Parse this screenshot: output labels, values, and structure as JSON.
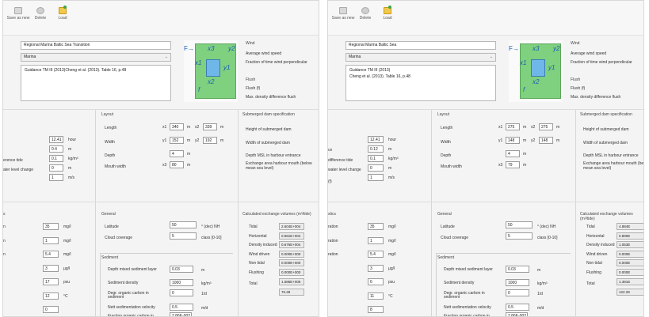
{
  "toolbar": {
    "save_label": "Save as new",
    "delete_label": "Delete",
    "load_label": "Load"
  },
  "left": {
    "title": "Regional Marina Baltic Sea Transition",
    "type_value": "Marina",
    "reference_lines": [
      "Guidance TM III (2013)Cheng et al. (2013). Table 16, p.48"
    ],
    "diagram": {
      "f_arrow": "F→",
      "x1": "x1",
      "x2": "x2",
      "x3": "x3",
      "y1": "y1",
      "y2": "y2",
      "f": "f"
    },
    "wind": {
      "header": "Wind",
      "items": [
        "Average wind speed",
        "Fraction of time wind perpendicular"
      ]
    },
    "flush": {
      "header": "Flush",
      "items": [
        "Flush (f)",
        "Max. density difference flush"
      ]
    },
    "sea_labels": [
      "erence tide",
      "ater level change"
    ],
    "sea_values": [
      "12.41",
      "0.4",
      "0.1",
      "0",
      "1"
    ],
    "sea_units": [
      "hour",
      "m",
      "kg/m³",
      "m",
      "m/s"
    ],
    "layout": {
      "header": "Layout",
      "length_label": "Length",
      "width_label": "Width",
      "depth_label": "Depth",
      "mouth_label": "Mouth width",
      "x1": "340",
      "x2": "339",
      "y1": "152",
      "y2": "192",
      "depth": "4",
      "x3": "80",
      "tag_x1": "x1",
      "tag_x2": "x2",
      "tag_y1": "y1",
      "tag_y2": "y2",
      "tag_x3": "x3",
      "unit": "m"
    },
    "submerged": {
      "header": "Submerged dam specification",
      "items": [
        "Height of submerged dam",
        "Width of submerged dam",
        "Depth MSL in harbour entrance",
        "Exchange area harbour mouth (below mean sea level)"
      ]
    },
    "chem_header": "s",
    "chem_rows": [
      {
        "label": "n",
        "value": "35",
        "unit": "mg/l"
      },
      {
        "label": "n",
        "value": "1",
        "unit": "mg/l"
      },
      {
        "label": "n",
        "value": "5.4",
        "unit": "mg/l"
      },
      {
        "label": "",
        "value": "3",
        "unit": "µg/l"
      },
      {
        "label": "",
        "value": "17",
        "unit": "psu"
      },
      {
        "label": "",
        "value": "12",
        "unit": "°C"
      },
      {
        "label": "",
        "value": "0",
        "unit": ""
      }
    ],
    "general": {
      "header": "General",
      "lat_label": "Latitude",
      "lat_value": "50",
      "lat_unit": "° (dec) NH",
      "cloud_label": "Cloud coverage",
      "cloud_value": "5",
      "cloud_unit": "class [0-10]"
    },
    "sediment": {
      "header": "Sediment",
      "rows": [
        {
          "label": "Depth mixed sediment layer",
          "value": "0.03",
          "unit": "m"
        },
        {
          "label": "Sediment density",
          "value": "1000",
          "unit": "kg/m³"
        },
        {
          "label": "Degr. organic carbon in sediment",
          "value": "0",
          "unit": "1/d"
        },
        {
          "label": "Nett sedimentation velocity",
          "value": "0.5",
          "unit": "m/d"
        },
        {
          "label": "Fraction organic carbon in sediment",
          "value": "2.86E-002",
          "unit": ""
        }
      ]
    },
    "calc": {
      "header": "Calculated exchange volumes (m³/tide)",
      "rows": [
        {
          "label": "Tidal",
          "value": "2.604E+004"
        },
        {
          "label": "Horizontal",
          "value": "0.581E+004"
        },
        {
          "label": "Density induced",
          "value": "0.676E+004"
        },
        {
          "label": "Wind driven",
          "value": "0.000E+000"
        },
        {
          "label": "Non tidal",
          "value": "0.000E+000"
        },
        {
          "label": "Flushing",
          "value": "0.000E+000"
        }
      ],
      "total_label": "Total",
      "total_value": "1.586E+005",
      "extra_value": "76.28"
    }
  },
  "right": {
    "title": "Regional Marina Baltic Sea",
    "type_value": "Marina",
    "reference_lines": [
      "Guidance TM III (2013)",
      "Cheng et al. (2013). Table 16, p.48"
    ],
    "diagram": {
      "f_arrow": "F→",
      "x1": "x1",
      "x2": "x2",
      "x3": "x3",
      "y1": "y1",
      "y2": "y2",
      "f": "f"
    },
    "wind": {
      "header": "Wind",
      "items": [
        "Average wind speed",
        "Fraction of time wind perpendicular"
      ]
    },
    "flush": {
      "header": "Flush",
      "items": [
        "Flush (f)",
        "Max. density difference flush"
      ]
    },
    "sea_labels": [
      "ce",
      "difference tide",
      "water level change",
      "(f)"
    ],
    "sea_values": [
      "12.41",
      "0.12",
      "0.1",
      "0",
      "1"
    ],
    "sea_units": [
      "hour",
      "m",
      "kg/m³",
      "m",
      "m/s"
    ],
    "layout": {
      "header": "Layout",
      "length_label": "Length",
      "width_label": "Width",
      "depth_label": "Depth",
      "mouth_label": "Mouth width",
      "x1": "275",
      "x2": "275",
      "y1": "148",
      "y2": "148",
      "depth": "4",
      "x3": "79",
      "tag_x1": "x1",
      "tag_x2": "x2",
      "tag_y1": "y1",
      "tag_y2": "y2",
      "tag_x3": "x3",
      "unit": "m"
    },
    "submerged": {
      "header": "Submerged dam specification",
      "items": [
        "Height of submerged dam",
        "Width of submerged dam",
        "Depth MSL in harbour entrance",
        "Exchange area harbour mouth (below mean sea level)"
      ]
    },
    "chem_header": "stics",
    "chem_rows": [
      {
        "label": "ration",
        "value": "35",
        "unit": "mg/l"
      },
      {
        "label": "ration",
        "value": "1",
        "unit": "mg/l"
      },
      {
        "label": "ration",
        "value": "5.4",
        "unit": "mg/l"
      },
      {
        "label": "",
        "value": "3",
        "unit": "µg/l"
      },
      {
        "label": "",
        "value": "6",
        "unit": "psu"
      },
      {
        "label": "",
        "value": "11",
        "unit": "°C"
      },
      {
        "label": "",
        "value": "8",
        "unit": ""
      }
    ],
    "general": {
      "header": "General",
      "lat_label": "Latitude",
      "lat_value": "50",
      "lat_unit": "° (dec) NH",
      "cloud_label": "Cloud coverage",
      "cloud_value": "5",
      "cloud_unit": "class [0-10]"
    },
    "sediment": {
      "header": "Sediment",
      "rows": [
        {
          "label": "Depth mixed sediment layer",
          "value": "0.03",
          "unit": "m"
        },
        {
          "label": "Sediment density",
          "value": "1000",
          "unit": "kg/m³"
        },
        {
          "label": "Degr. organic carbon in sediment",
          "value": "0",
          "unit": "1/d"
        },
        {
          "label": "Nett sedimentation velocity",
          "value": "0.5",
          "unit": "m/d"
        },
        {
          "label": "Fraction organic carbon in sediment",
          "value": "2.86E-002",
          "unit": ""
        }
      ]
    },
    "calc": {
      "header": "Calculated exchange volumes (m³/tide)",
      "rows": [
        {
          "label": "Tidal",
          "value": "4.884E"
        },
        {
          "label": "Horizontal",
          "value": "0.890E"
        },
        {
          "label": "Density induced",
          "value": "1.053E"
        },
        {
          "label": "Wind driven",
          "value": "0.000E"
        },
        {
          "label": "Non tidal",
          "value": "0.000E"
        },
        {
          "label": "Flushing",
          "value": "0.000E"
        }
      ],
      "total_label": "Total",
      "total_value": "1.391E",
      "extra_value": "122.29"
    }
  }
}
